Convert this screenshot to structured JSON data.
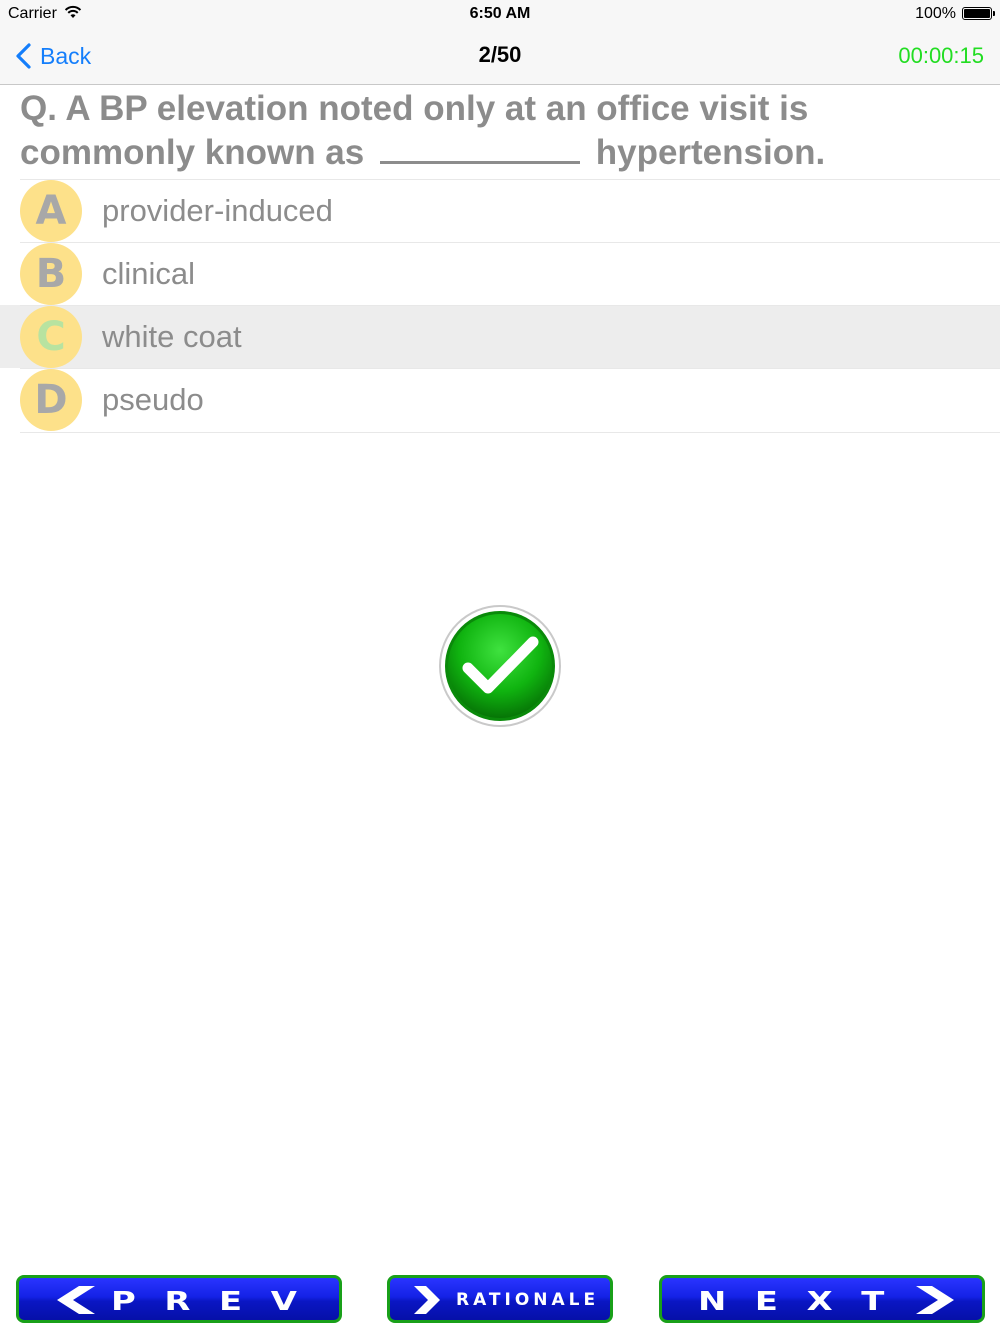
{
  "status_bar": {
    "carrier": "Carrier",
    "time": "6:50 AM",
    "battery": "100%"
  },
  "nav": {
    "back_label": "Back",
    "title": "2/50",
    "timer": "00:00:15"
  },
  "question": {
    "prefix": "Q. A BP elevation noted only at an office visit is commonly known as",
    "suffix": "hypertension."
  },
  "options": [
    {
      "letter": "A",
      "text": "provider-induced",
      "selected": false
    },
    {
      "letter": "B",
      "text": "clinical",
      "selected": false
    },
    {
      "letter": "C",
      "text": "white coat",
      "selected": true
    },
    {
      "letter": "D",
      "text": "pseudo",
      "selected": false
    }
  ],
  "result_icon": "check-circle-icon",
  "buttons": {
    "prev": "PREV",
    "rationale": "RATIONALE",
    "next": "NEXT"
  },
  "colors": {
    "accent": "#147efb",
    "timer": "#22dd22",
    "option_circle": "#fde18a",
    "button_fill": "#1422e6",
    "button_border": "#19a019"
  }
}
